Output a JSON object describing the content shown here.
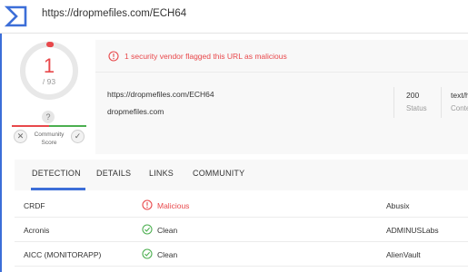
{
  "url": "https://dropmefiles.com/ECH64",
  "detection_score": {
    "flagged": "1",
    "total": "/ 93",
    "fraction": 0.0108
  },
  "community_score": {
    "question": "?",
    "label": "Community Score",
    "dislike_glyph": "✕",
    "like_glyph": "✓"
  },
  "alert": {
    "text": "1 security vendor flagged this URL as malicious",
    "icon": "exclamation-circle-icon"
  },
  "info": {
    "url": "https://dropmefiles.com/ECH64",
    "domain": "dropmefiles.com",
    "stats": [
      {
        "value": "200",
        "label": "Status"
      },
      {
        "value": "text/h",
        "label": "Conte"
      }
    ]
  },
  "tabs": [
    "DETECTION",
    "DETAILS",
    "LINKS",
    "COMMUNITY"
  ],
  "active_tab": "DETECTION",
  "detections": [
    {
      "vendor": "CRDF",
      "result": "Malicious",
      "status": "malicious",
      "other_vendor": "Abusix"
    },
    {
      "vendor": "Acronis",
      "result": "Clean",
      "status": "clean",
      "other_vendor": "ADMINUSLabs"
    },
    {
      "vendor": "AICC (MONITORAPP)",
      "result": "Clean",
      "status": "clean",
      "other_vendor": "AlienVault"
    }
  ],
  "colors": {
    "accent": "#3c6ed8",
    "malicious": "#e8484b",
    "clean": "#4caf50"
  }
}
